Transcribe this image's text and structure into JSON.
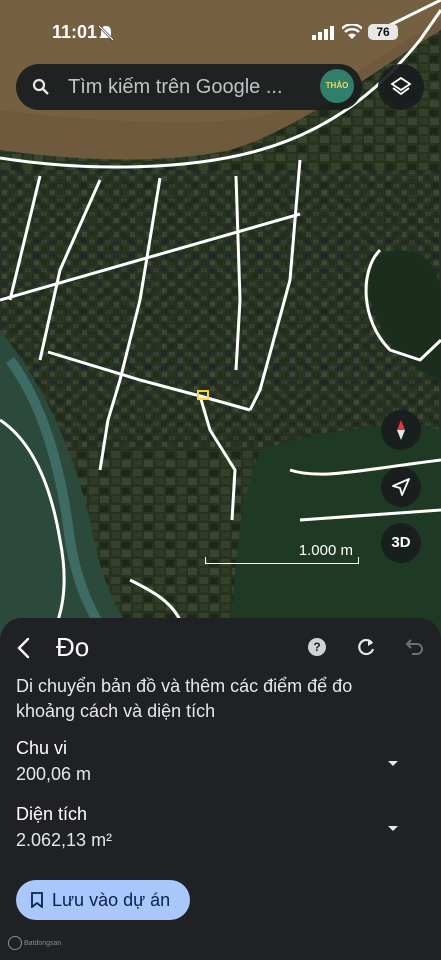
{
  "status_bar": {
    "time": "11:01",
    "battery": "76"
  },
  "search": {
    "placeholder": "Tìm kiếm trên Google ...",
    "avatar_text": "THẢO TẤN"
  },
  "map": {
    "scale_label": "1.000 m",
    "compass_icon": "compass-icon",
    "location_icon": "location-arrow-icon",
    "view_3d_label": "3D",
    "layers_icon": "layers-icon"
  },
  "sheet": {
    "title": "Đo",
    "help_icon": "help-icon",
    "redo_icon": "redo-icon",
    "undo_icon": "undo-icon",
    "description": "Di chuyển bản đồ và thêm các điểm để đo khoảng cách và diện tích",
    "perimeter": {
      "label": "Chu vi",
      "value": "200,06 m"
    },
    "area": {
      "label": "Diện tích",
      "value": "2.062,13 m²"
    },
    "save_button": "Lưu vào dự án"
  },
  "watermark": "Batdongsan"
}
